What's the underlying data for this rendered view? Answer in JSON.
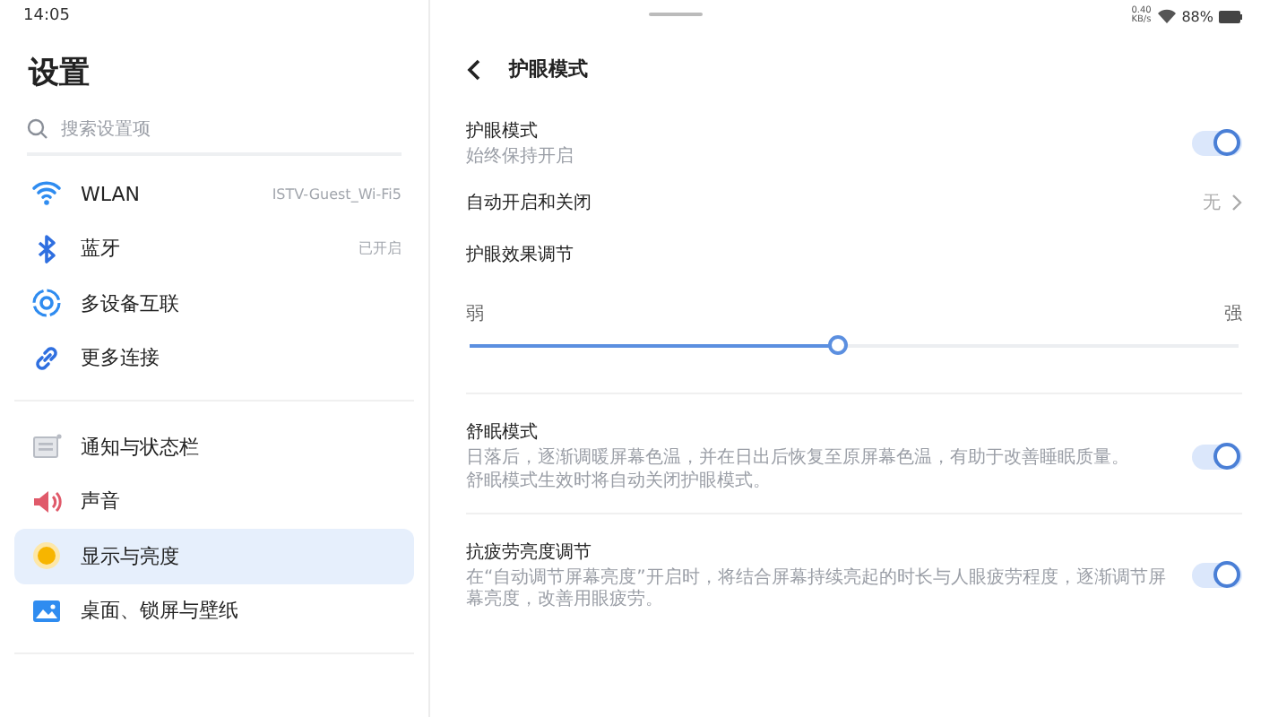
{
  "status_bar": {
    "time": "14:05",
    "network_speed": "0.40 KB/s",
    "battery": "88%"
  },
  "sidebar": {
    "title": "设置",
    "search": {
      "placeholder": "搜索设置项"
    },
    "groups": [
      {
        "items": [
          {
            "label": "WLAN",
            "value": "ISTV-Guest_Wi-Fi5",
            "selected": false
          },
          {
            "label": "蓝牙",
            "value": "已开启",
            "selected": false
          },
          {
            "label": "多设备互联",
            "selected": false
          },
          {
            "label": "更多连接",
            "selected": false
          }
        ]
      },
      {
        "items": [
          {
            "label": "通知与状态栏",
            "selected": false
          },
          {
            "label": "声音",
            "selected": false
          },
          {
            "label": "显示与亮度",
            "selected": true
          },
          {
            "label": "桌面、锁屏与壁纸",
            "selected": false
          }
        ]
      }
    ]
  },
  "detail": {
    "title": "护眼模式",
    "rows": [
      {
        "kind": "toggle",
        "label": "护眼模式",
        "description": [
          "始终保持开启"
        ],
        "on": true
      },
      {
        "kind": "link",
        "label": "自动开启和关闭",
        "value": "无"
      },
      {
        "kind": "slider",
        "label": "护眼效果调节",
        "min_label": "弱",
        "max_label": "强",
        "level": 0.48
      },
      {
        "kind": "toggle",
        "label": "舒眠模式",
        "description": [
          "日落后，逐渐调暖屏幕色温，并在日出后恢复至原屏幕色温，有助于改善睡眠质量。",
          "舒眠模式生效时将自动关闭护眼模式。"
        ],
        "on": true
      },
      {
        "kind": "toggle",
        "label": "抗疲劳亮度调节",
        "description": [
          "在“自动调节屏幕亮度”开启时，将结合屏幕持续亮起的时长与人眼疲劳程度，逐渐调节屏幕亮度，改善用眼疲劳。"
        ],
        "on": true
      }
    ]
  }
}
